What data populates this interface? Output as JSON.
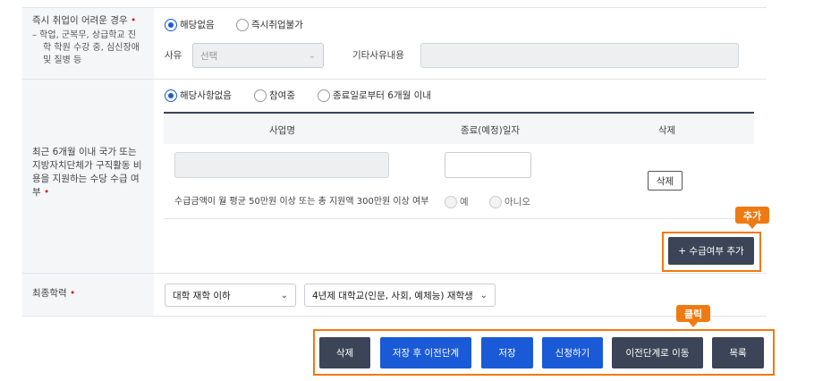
{
  "row_immediate": {
    "label": "즉시 취업이 어려운 경우",
    "required_mark": "•",
    "note_line1": "–  학업, 군복무, 상급학교 진",
    "note_line2": "학 학원 수강 중, 심신장애",
    "note_line3": "및 질병 등",
    "radio_none": "해당없음",
    "radio_impossible": "즉시취업불가",
    "reason_label": "사유",
    "reason_select_value": "선택",
    "other_reason_label": "기타사유내용"
  },
  "row_subsidy": {
    "label_line1": "최근 6개월 이내 국가 또는",
    "label_line2": "지방자치단체가 구직활동 비",
    "label_line3": "용을 지원하는 수당 수급 여",
    "label_line4": "부",
    "required_mark": "•",
    "radio_none": "해당사항없음",
    "radio_participating": "참여중",
    "radio_within6": "종료일로부터 6개월 이내",
    "col_business": "사업명",
    "col_enddate": "종료(예정)일자",
    "col_delete": "삭제",
    "delete_button": "삭제",
    "question": "수급금액이 월 평균 50만원 이상 또는 총 지원액 300만원 이상 여부",
    "radio_yes": "예",
    "radio_no": "아니오",
    "add_button": "+ 수급여부 추가",
    "add_tag": "추가"
  },
  "row_education": {
    "label": "최종학력",
    "required_mark": "•",
    "select1_value": "대학 재학 이하",
    "select2_value": "4년제 대학교(인문, 사회, 예체능) 재학생"
  },
  "actions": {
    "click_tag": "클릭",
    "delete": "삭제",
    "save_prev": "저장 후 이전단계",
    "save": "저장",
    "apply": "신청하기",
    "go_prev": "이전단계로 이동",
    "list": "목록"
  }
}
